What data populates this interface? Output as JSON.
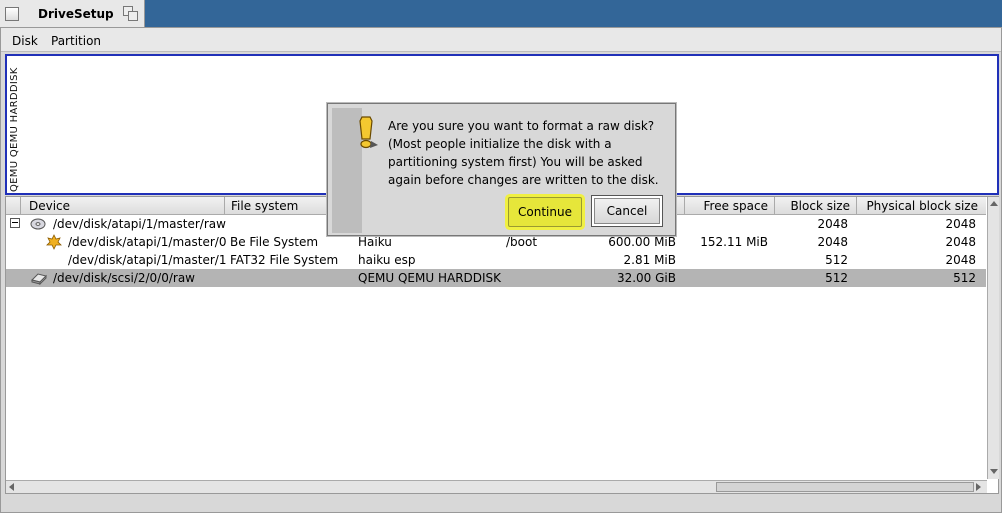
{
  "window": {
    "title": "DriveSetup"
  },
  "menu": {
    "items": [
      "Disk",
      "Partition"
    ]
  },
  "disk_map": {
    "label": "QEMU QEMU HARDDISK"
  },
  "list": {
    "columns": [
      "Device",
      "File system",
      "",
      "",
      "",
      "Free space",
      "Block size",
      "Physical block size"
    ],
    "rows": [
      {
        "device": "/dev/disk/atapi/1/master/raw",
        "filesystem": "",
        "volume": "",
        "mount": "",
        "size": "",
        "free": "",
        "block": "2048",
        "phys": "2048"
      },
      {
        "device": "/dev/disk/atapi/1/master/0",
        "filesystem": "Be File System",
        "volume": "Haiku",
        "mount": "/boot",
        "size": "600.00 MiB",
        "free": "152.11 MiB",
        "block": "2048",
        "phys": "2048"
      },
      {
        "device": "/dev/disk/atapi/1/master/1",
        "filesystem": "FAT32 File System",
        "volume": "haiku esp",
        "mount": "",
        "size": "2.81 MiB",
        "free": "",
        "block": "512",
        "phys": "2048"
      },
      {
        "device": "/dev/disk/scsi/2/0/0/raw",
        "filesystem": "",
        "volume": "QEMU QEMU HARDDISK",
        "mount": "",
        "size": "32.00 GiB",
        "free": "",
        "block": "512",
        "phys": "512"
      }
    ]
  },
  "dialog": {
    "message": "Are you sure you want to format a raw disk? (Most people initialize the disk with a partitioning system first) You will be asked again before changes are written to the disk.",
    "continue_label": "Continue",
    "cancel_label": "Cancel"
  },
  "colors": {
    "desktop": "#336698",
    "selection": "#b4b4b4",
    "highlight": "#e6e63a",
    "disk_map_border": "#2030b8"
  }
}
